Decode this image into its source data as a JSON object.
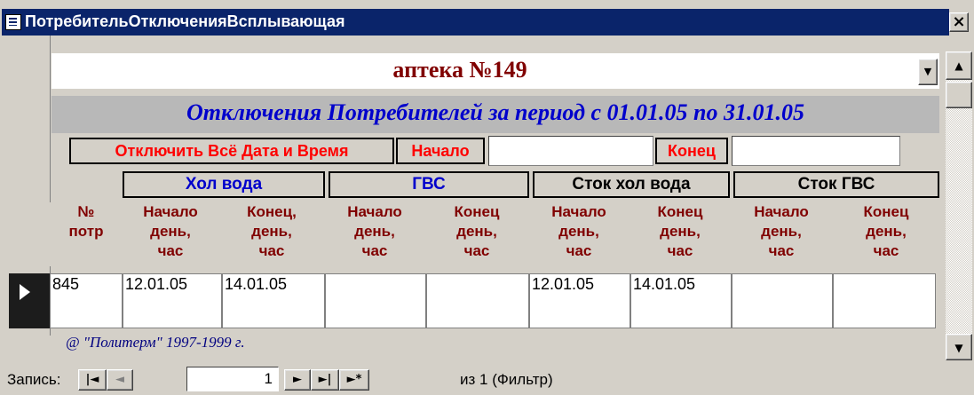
{
  "window": {
    "title": "ПотребительОтключенияВсплывающая",
    "close_label": "×"
  },
  "header": {
    "name": "аптека №149",
    "combo_arrow": "▼"
  },
  "subtitle": "Отключения Потребителей за период с 01.01.05 по 31.01.05",
  "controls": {
    "disconnect_label": "Отключить Всё Дата и Время",
    "start_label": "Начало",
    "start_value": "",
    "end_label": "Конец",
    "end_value": ""
  },
  "groups": [
    {
      "label": "Хол вода",
      "color": "#0000cc"
    },
    {
      "label": "ГВС",
      "color": "#0000cc"
    },
    {
      "label": "Сток хол вода",
      "color": "#000000"
    },
    {
      "label": "Сток ГВС",
      "color": "#000000"
    }
  ],
  "columns": [
    "№\nпотр",
    "Начало\nдень,\nчас",
    "Конец,\nдень,\nчас",
    "Начало\nдень,\nчас",
    "Конец\nдень,\nчас",
    "Начало\nдень,\nчас",
    "Конец\nдень,\nчас",
    "Начало\nдень,\nчас",
    "Конец\nдень,\nчас"
  ],
  "rows": [
    [
      "845",
      "12.01.05",
      "14.01.05",
      "",
      "",
      "12.01.05",
      "14.01.05",
      "",
      ""
    ]
  ],
  "footer": {
    "copyright": "@ \"Политерм\" 1997-1999 г."
  },
  "navigation": {
    "record_label": "Запись:",
    "first": "|◄",
    "prev": "◄",
    "current": "1",
    "next": "►",
    "last": "►|",
    "new": "►*",
    "info": "из 1 (Фильтр)"
  },
  "scrollbar": {
    "up": "▲",
    "down": "▼"
  }
}
